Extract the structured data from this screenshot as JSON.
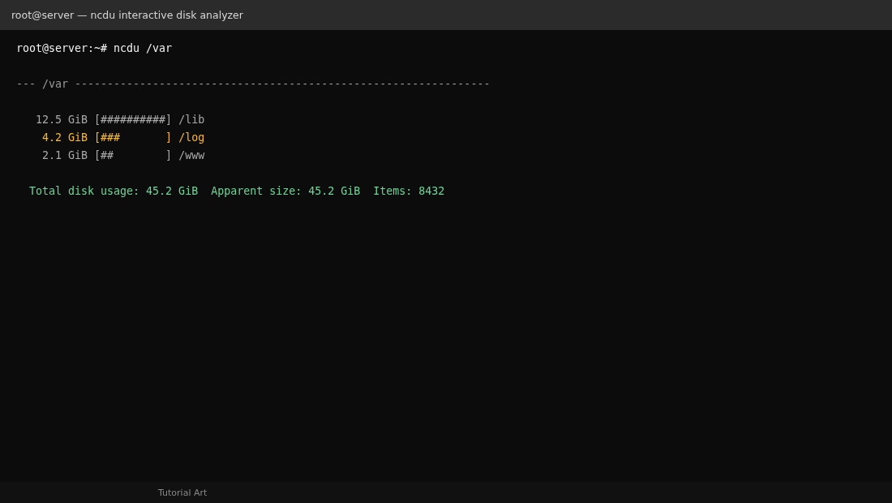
{
  "window": {
    "title": "root@server — ncdu interactive disk analyzer"
  },
  "terminal": {
    "prompt": "root@server:~# ncdu /var",
    "header": "--- /var ----------------------------------------------------------------",
    "rows": [
      {
        "size": "12.5 GiB",
        "bar": "[##########]",
        "path": "/lib",
        "selected": false
      },
      {
        "size": "4.2 GiB",
        "bar": "[###       ]",
        "path": "/log",
        "selected": true
      },
      {
        "size": "2.1 GiB",
        "bar": "[##        ]",
        "path": "/www",
        "selected": false
      }
    ],
    "summary": "Total disk usage: 45.2 GiB  Apparent size: 45.2 GiB  Items: 8432"
  },
  "status_bar": {
    "text": "Tutorial Art"
  }
}
